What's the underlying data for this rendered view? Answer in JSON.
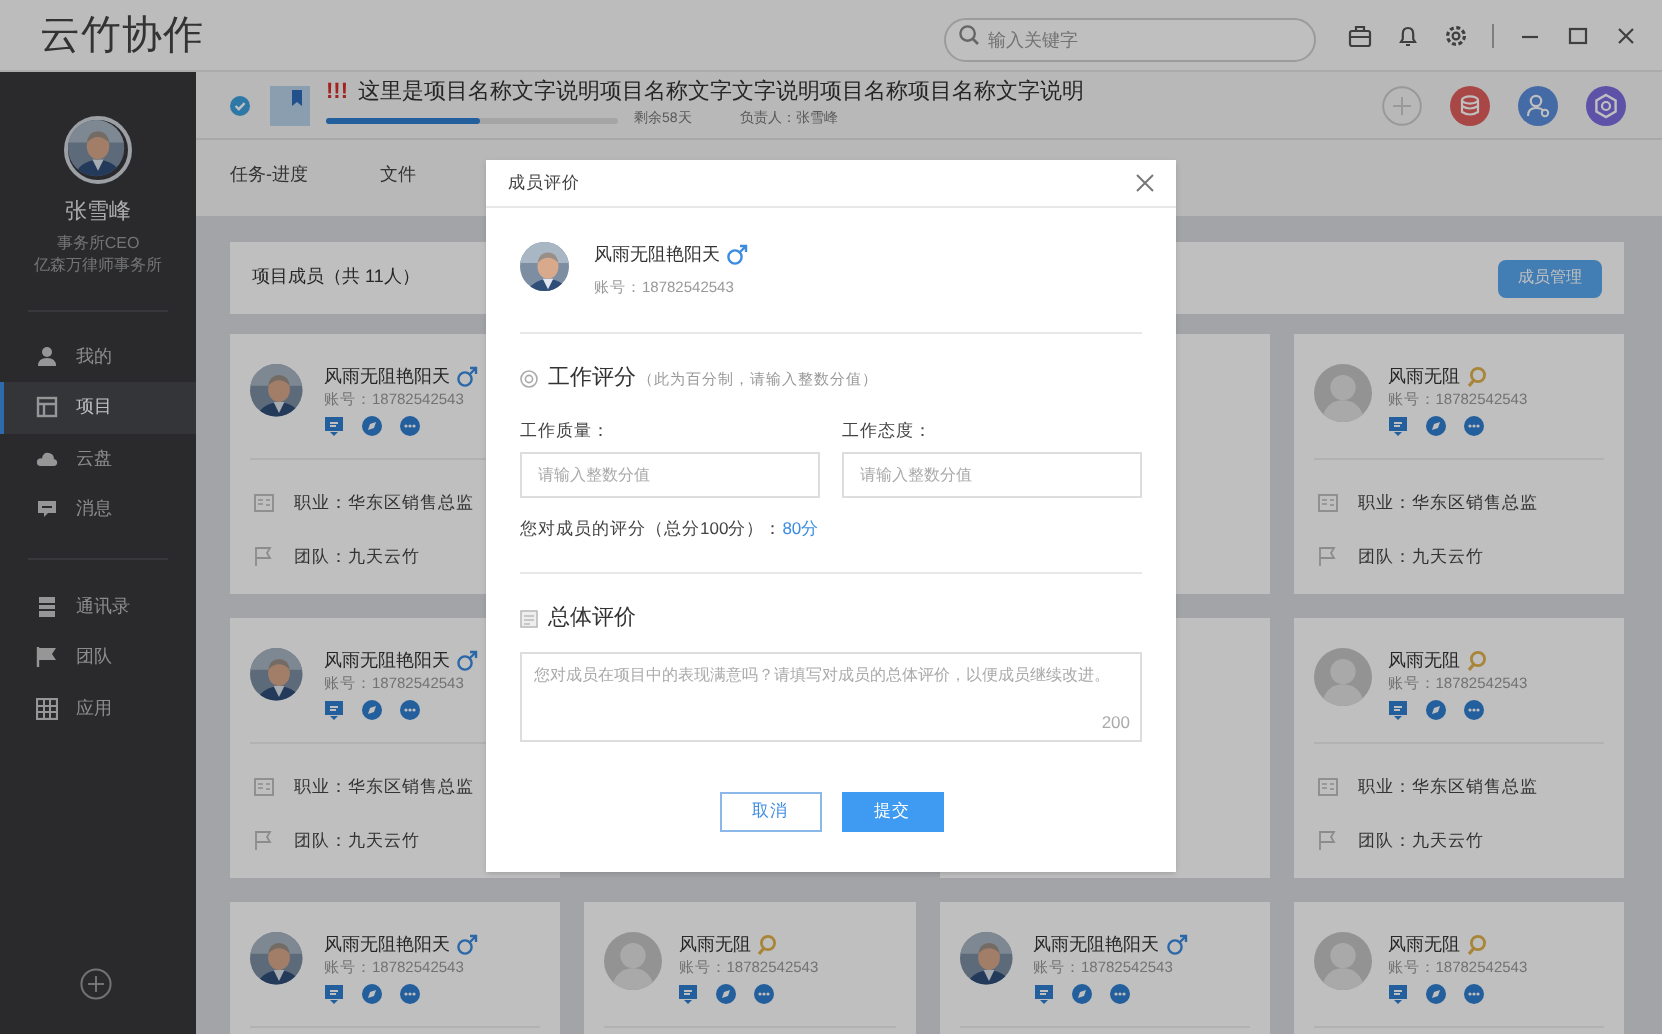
{
  "app": {
    "title": "云竹协作"
  },
  "search": {
    "placeholder": "输入关键字"
  },
  "user": {
    "name": "张雪峰",
    "role": "事务所CEO",
    "company": "亿森万律师事务所"
  },
  "nav": [
    {
      "label": "我的",
      "kind": "person",
      "selected": false
    },
    {
      "label": "项目",
      "kind": "project",
      "selected": true
    },
    {
      "label": "云盘",
      "kind": "cloud",
      "selected": false
    },
    {
      "label": "消息",
      "kind": "message",
      "selected": false
    },
    {
      "label": "通讯录",
      "kind": "contacts",
      "selected": false,
      "group_start": true
    },
    {
      "label": "团队",
      "kind": "team",
      "selected": false
    },
    {
      "label": "应用",
      "kind": "apps",
      "selected": false
    }
  ],
  "project": {
    "priority": "!!!",
    "title": "这里是项目名称文字说明项目名称文字文字说明项目名称项目名称文字说明",
    "progress": {
      "level": 0.53
    },
    "remaining": "剩余58天",
    "owner": "负责人：张雪峰"
  },
  "tabs": [
    {
      "label": "任务-进度",
      "selected": false
    },
    {
      "label": "文件",
      "selected": false
    }
  ],
  "members_panel": {
    "title": "项目成员（共 11人）",
    "button": "成员管理"
  },
  "cards": [
    {
      "kind": "member",
      "name": "风雨无阻艳阳天",
      "gender": {
        "kind": "male"
      },
      "account": "账号：18782542543",
      "job": "职业：华东区销售总监",
      "team": "团队：九天云竹"
    },
    {
      "kind": "covered"
    },
    {
      "kind": "member",
      "avatar": {
        "kind": "default"
      },
      "name": "风雨无阻",
      "gender": {
        "kind": "female"
      },
      "account": "账号：18782542543",
      "job": "职业：华东区销售总监",
      "team": "团队：九天云竹"
    },
    {
      "kind": "member",
      "name": "风雨无阻艳阳天",
      "gender": {
        "kind": "male"
      },
      "account": "账号：18782542543",
      "job": "职业：华东区销售总监",
      "team": "团队：九天云竹"
    },
    {
      "kind": "covered"
    },
    {
      "kind": "member",
      "avatar": {
        "kind": "default"
      },
      "name": "风雨无阻",
      "gender": {
        "kind": "female"
      },
      "account": "账号：18782542543",
      "job": "职业：华东区销售总监",
      "team": "团队：九天云竹"
    },
    {
      "kind": "member",
      "name": "风雨无阻艳阳天",
      "gender": {
        "kind": "male"
      },
      "account": "账号：18782542543"
    },
    {
      "kind": "member",
      "avatar": {
        "kind": "default"
      },
      "name": "风雨无阻",
      "gender": {
        "kind": "female"
      },
      "account": "账号：18782542543"
    },
    {
      "kind": "member",
      "name": "风雨无阻艳阳天",
      "gender": {
        "kind": "male"
      },
      "account": "账号：18782542543"
    },
    {
      "kind": "member",
      "avatar": {
        "kind": "default"
      },
      "name": "风雨无阻",
      "gender": {
        "kind": "female"
      },
      "account": "账号：18782542543"
    }
  ],
  "dialog": {
    "title": "成员评价",
    "member": {
      "name": "风雨无阻艳阳天",
      "gender": {
        "kind": "male"
      },
      "account": "账号：18782542543"
    },
    "score_section": {
      "title": "工作评分",
      "hint": "（此为百分制，请输入整数分值）"
    },
    "fields": [
      {
        "label": "工作质量：",
        "placeholder": "请输入整数分值"
      },
      {
        "label": "工作态度：",
        "placeholder": "请输入整数分值"
      }
    ],
    "total": {
      "label": "您对成员的评分（总分100分）：",
      "value": "80分"
    },
    "review": {
      "title": "总体评价",
      "placeholder": "您对成员在项目中的表现满意吗？请填写对成员的总体评价，以便成员继续改进。",
      "counter": "200"
    },
    "buttons": [
      {
        "label": "取消",
        "kind": "secondary"
      },
      {
        "label": "提交",
        "kind": "primary"
      }
    ]
  }
}
